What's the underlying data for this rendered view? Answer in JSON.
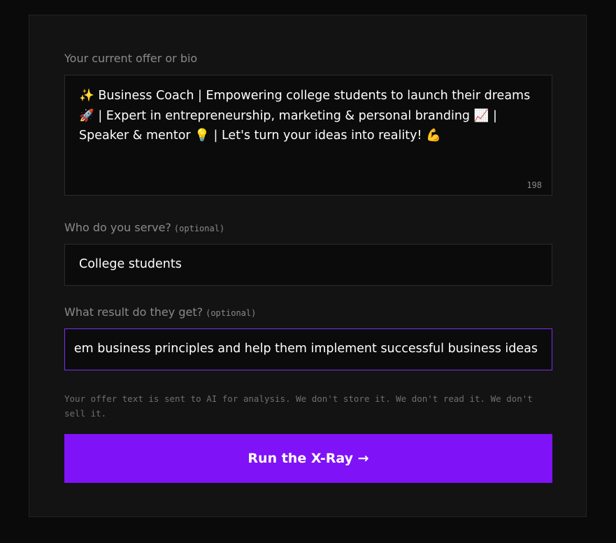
{
  "form": {
    "bio": {
      "label": "Your current offer or bio",
      "value": "✨ Business Coach | Empowering college students to launch their dreams 🚀 | Expert in entrepreneurship, marketing & personal branding 📈 | Speaker & mentor 💡 | Let's turn your ideas into reality! 💪",
      "char_count": "198"
    },
    "serve": {
      "label": "Who do you serve?",
      "optional": "(optional)",
      "value": "College students"
    },
    "result": {
      "label": "What result do they get?",
      "optional": "(optional)",
      "value": "em business principles and help them implement successful business ideas"
    },
    "disclaimer": "Your offer text is sent to AI for analysis. We don't store it. We don't read it. We don't sell it.",
    "submit_label": "Run the X-Ray →"
  },
  "colors": {
    "accent": "#7f12f7",
    "focus_border": "#7c2ef5",
    "card_background": "#131313",
    "page_background": "#0a0a0a"
  }
}
